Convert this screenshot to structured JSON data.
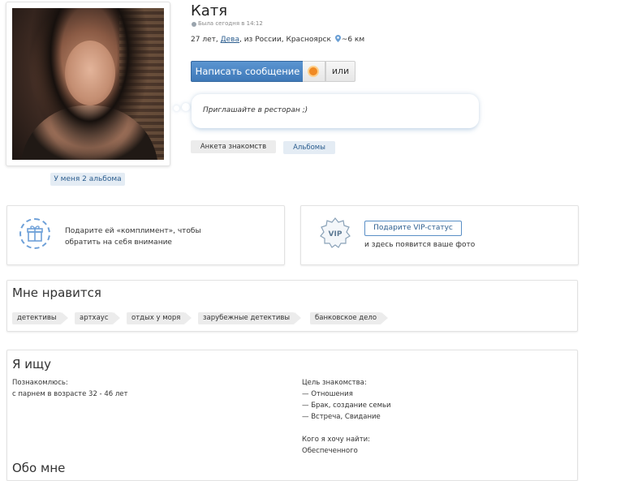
{
  "profile": {
    "name": "Катя",
    "status": "Была сегодня в 14:12",
    "age": "27 лет,",
    "zodiac": "Дева",
    "location": ", из России, Красноярск",
    "distance": "~6 км",
    "albums_link": "У меня 2 альбома"
  },
  "actions": {
    "message_button": "Написать сообщение",
    "or_button": "или"
  },
  "bubble": {
    "text": "Приглашайте в ресторан ;)"
  },
  "tabs": [
    {
      "label": "Анкета знакомств",
      "active": true
    },
    {
      "label": "Альбомы",
      "active": false
    }
  ],
  "promo": {
    "compliment_line1": "Подарите ей «комплимент», чтобы",
    "compliment_line2": "обратить на себя внимание",
    "vip_badge": "VIP",
    "vip_button": "Подарите VIP-статус",
    "vip_sub": "и здесь появится ваше фото"
  },
  "likes": {
    "title": "Мне нравится",
    "tags": [
      "детективы",
      "артхаус",
      "отдых у моря",
      "зарубежные детективы",
      "банковское дело"
    ]
  },
  "seeking": {
    "title": "Я ищу",
    "meet_label": "Познакомлюсь:",
    "meet_value": "с парнем в возрасте 32 - 46 лет",
    "purpose_label": "Цель знакомства:",
    "purposes": [
      "— Отношения",
      "— Брак, создание семьи",
      "— Встреча, Свидание"
    ],
    "find_label": "Кого я хочу найти:",
    "find_value": "Обеспеченного"
  },
  "about": {
    "title": "Обо мне"
  },
  "colors": {
    "accent": "#3f79b8",
    "link": "#2b5d8e",
    "tag_bg": "#ececec"
  }
}
